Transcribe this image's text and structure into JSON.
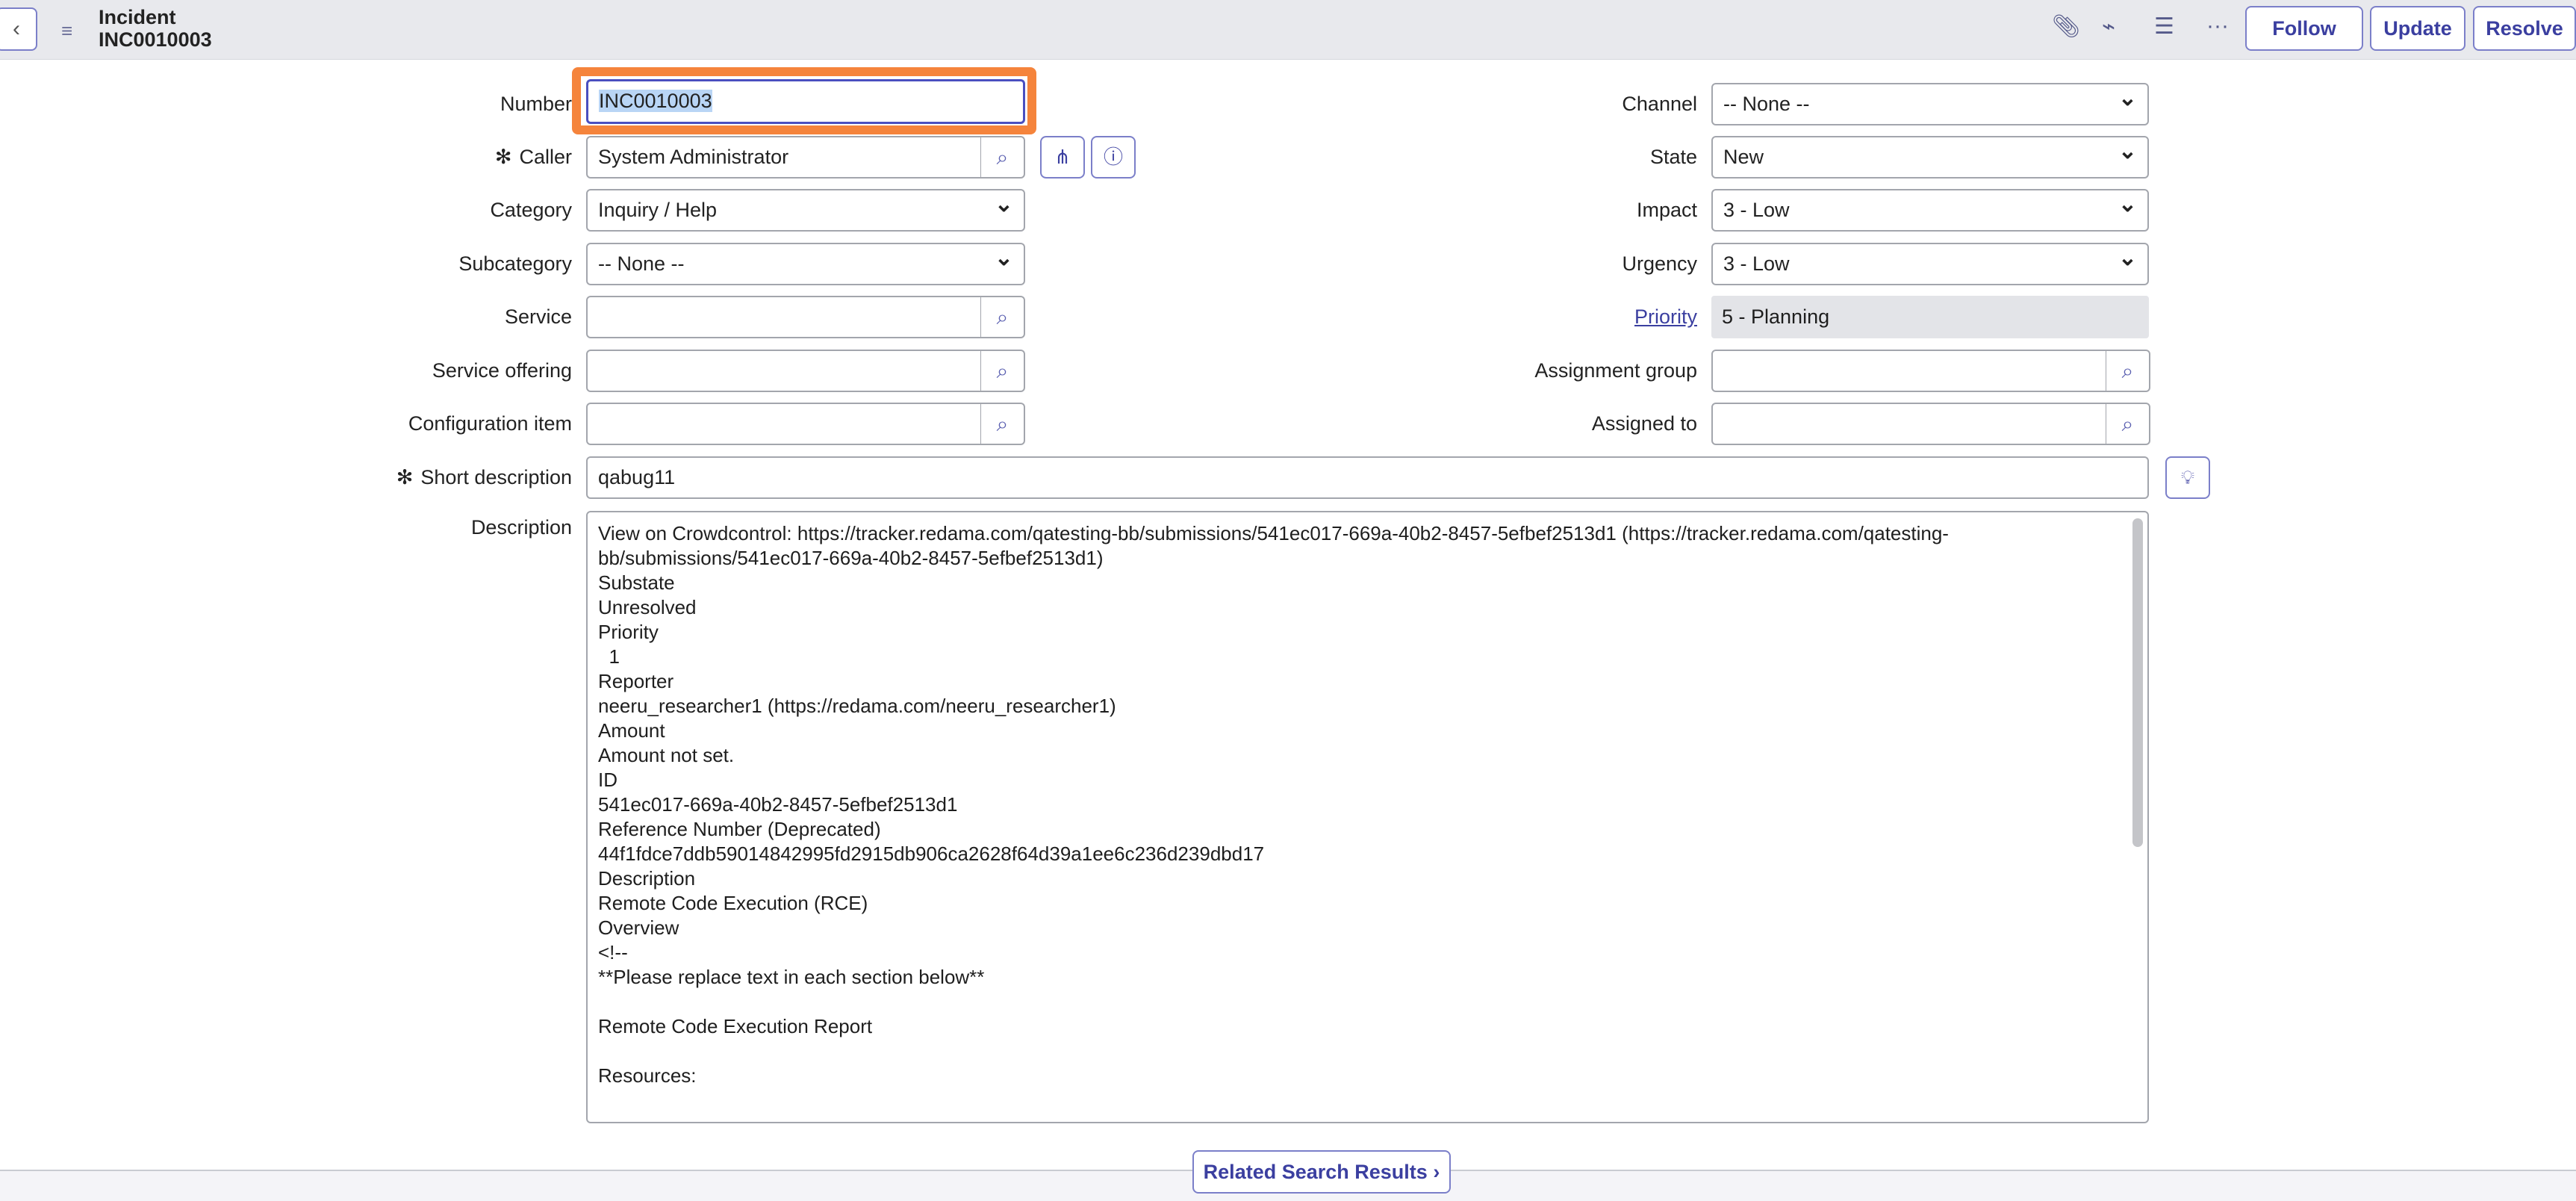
{
  "header": {
    "title": "Incident",
    "number": "INC0010003",
    "icons": [
      "back-icon",
      "menu-icon",
      "paperclip-icon",
      "activity-icon",
      "settings-sliders-icon",
      "more-icon"
    ],
    "buttons": {
      "follow": "Follow",
      "update": "Update",
      "resolve": "Resolve"
    }
  },
  "form": {
    "number": {
      "label": "Number",
      "value": "INC0010003"
    },
    "caller": {
      "label": "Caller",
      "value": "System Administrator"
    },
    "category": {
      "label": "Category",
      "value": "Inquiry / Help"
    },
    "subcategory": {
      "label": "Subcategory",
      "value": "-- None --"
    },
    "service": {
      "label": "Service",
      "value": ""
    },
    "service_offering": {
      "label": "Service offering",
      "value": ""
    },
    "configuration_item": {
      "label": "Configuration item",
      "value": ""
    },
    "short_description": {
      "label": "Short description",
      "value": "qabug11"
    },
    "description": {
      "label": "Description",
      "lines": [
        "View on Crowdcontrol: https://tracker.redama.com/qatesting-bb/submissions/541ec017-669a-40b2-8457-5efbef2513d1 (https://tracker.redama.com/qatesting-",
        "bb/submissions/541ec017-669a-40b2-8457-5efbef2513d1)",
        "Substate",
        "Unresolved",
        "Priority",
        "  1",
        "Reporter",
        "neeru_researcher1 (https://redama.com/neeru_researcher1)",
        "Amount",
        "Amount not set.",
        "ID",
        "541ec017-669a-40b2-8457-5efbef2513d1",
        "Reference Number (Deprecated)",
        "44f1fdce7ddb59014842995fd2915db906ca2628f64d39a1ee6c236d239dbd17",
        "Description",
        "Remote Code Execution (RCE)",
        "Overview",
        "<!--",
        "**Please replace text in each section below**",
        "",
        "Remote Code Execution Report",
        "",
        "Resources:"
      ]
    },
    "channel": {
      "label": "Channel",
      "value": "-- None --"
    },
    "state": {
      "label": "State",
      "value": "New"
    },
    "impact": {
      "label": "Impact",
      "value": "3 - Low"
    },
    "urgency": {
      "label": "Urgency",
      "value": "3 - Low"
    },
    "priority": {
      "label": "Priority",
      "value": "5 - Planning"
    },
    "assignment_group": {
      "label": "Assignment group",
      "value": ""
    },
    "assigned_to": {
      "label": "Assigned to",
      "value": ""
    }
  },
  "footer": {
    "related": "Related Search Results"
  },
  "colors": {
    "accent": "#3b3fa0",
    "highlight": "#f5843c"
  }
}
